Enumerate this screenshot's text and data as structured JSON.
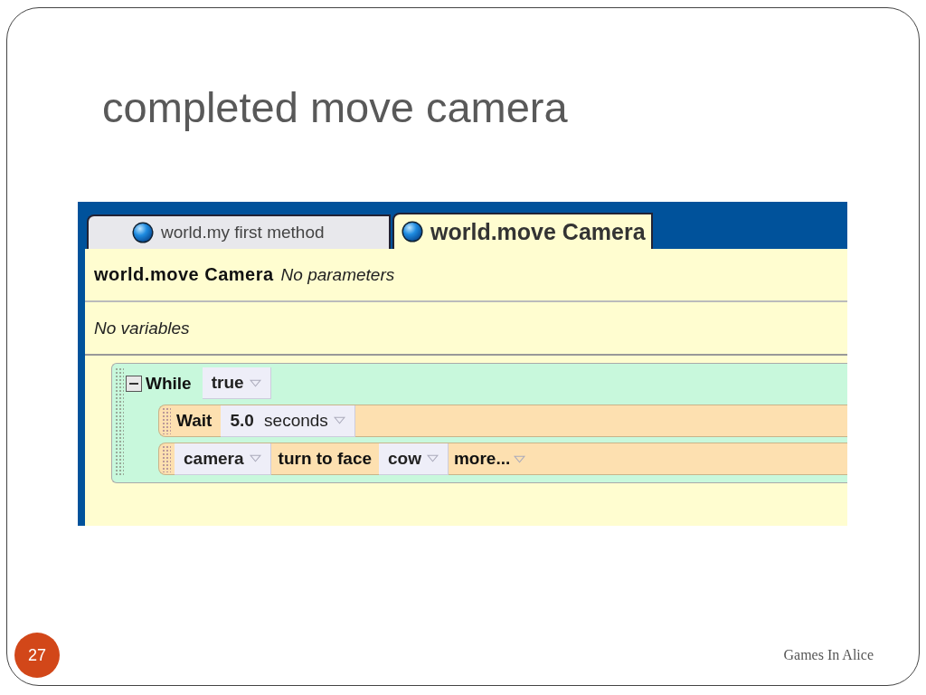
{
  "slide": {
    "title": "completed move camera",
    "page_number": "27",
    "footer": "Games In Alice"
  },
  "editor": {
    "tabs": [
      {
        "label": "world.my first method",
        "selected": false
      },
      {
        "label": "world.move Camera",
        "selected": true
      }
    ],
    "method_name": "world.move Camera",
    "parameters": "No parameters",
    "variables": "No variables",
    "loop": {
      "keyword": "While",
      "condition": "true",
      "expanded": true,
      "statements": [
        {
          "kind": "wait",
          "keyword": "Wait",
          "amount": "5.0",
          "unit": "seconds"
        },
        {
          "kind": "turn",
          "object": "camera",
          "action": "turn to face",
          "target": "cow",
          "more": "more..."
        }
      ]
    }
  }
}
